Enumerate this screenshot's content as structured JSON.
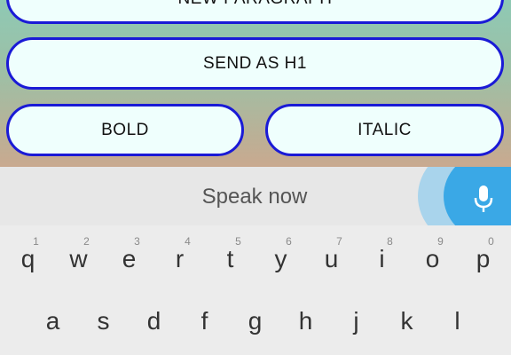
{
  "buttons": {
    "new_paragraph": "NEW PARAGRAPH",
    "send_h1": "SEND AS H1",
    "bold": "BOLD",
    "italic": "ITALIC"
  },
  "voice": {
    "prompt": "Speak now",
    "mic_icon": "microphone-icon"
  },
  "keyboard": {
    "row1": [
      {
        "ch": "q",
        "hint": "1"
      },
      {
        "ch": "w",
        "hint": "2"
      },
      {
        "ch": "e",
        "hint": "3"
      },
      {
        "ch": "r",
        "hint": "4"
      },
      {
        "ch": "t",
        "hint": "5"
      },
      {
        "ch": "y",
        "hint": "6"
      },
      {
        "ch": "u",
        "hint": "7"
      },
      {
        "ch": "i",
        "hint": "8"
      },
      {
        "ch": "o",
        "hint": "9"
      },
      {
        "ch": "p",
        "hint": "0"
      }
    ],
    "row2": [
      {
        "ch": "a"
      },
      {
        "ch": "s"
      },
      {
        "ch": "d"
      },
      {
        "ch": "f"
      },
      {
        "ch": "g"
      },
      {
        "ch": "h"
      },
      {
        "ch": "j"
      },
      {
        "ch": "k"
      },
      {
        "ch": "l"
      }
    ]
  },
  "colors": {
    "button_border": "#1a1ad6",
    "button_fill": "#effffd",
    "mic_blue": "#3aa8e6"
  }
}
